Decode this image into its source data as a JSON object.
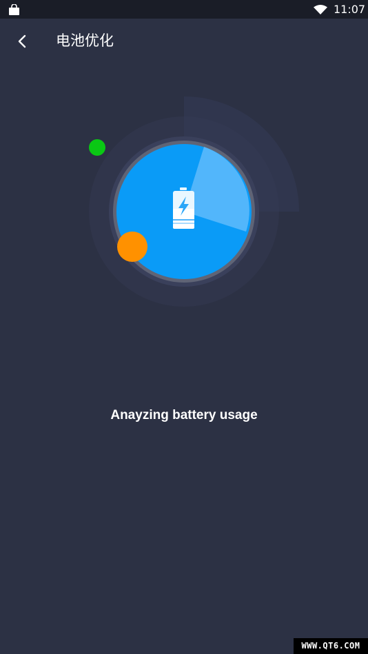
{
  "status_bar": {
    "time": "11:07",
    "icons": [
      "shopping-bag-icon",
      "wifi-icon",
      "battery-icon"
    ]
  },
  "header": {
    "title": "电池优化",
    "back_icon": "chevron-left-icon"
  },
  "gauge": {
    "center_icon": "battery-charging-icon",
    "colors": {
      "main": "#0a9bf7",
      "highlight": "#52b6fb",
      "ring": "#636778",
      "halo": "#363b55",
      "dot_green": "#0ac814",
      "dot_orange": "#ff9100"
    }
  },
  "status": {
    "message": "Anayzing battery usage"
  },
  "watermark": {
    "text": "WWW.QT6.COM"
  }
}
